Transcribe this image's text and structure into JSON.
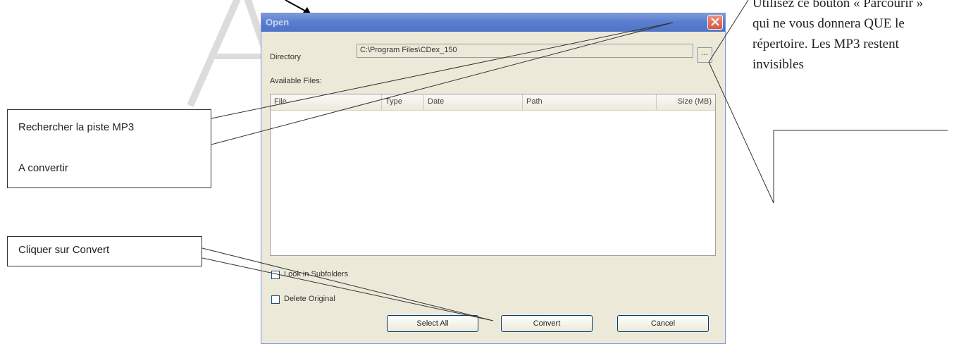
{
  "dialog": {
    "title": "Open",
    "directory_label": "Directory",
    "directory_value": "C:\\Program Files\\CDex_150",
    "browse_label": "...",
    "available_files_label": "Available Files:",
    "columns": [
      "File",
      "Type",
      "Date",
      "Path",
      "Size (MB)"
    ],
    "look_in_subfolders_label": "Look in Subfolders",
    "delete_original_label": "Delete Original",
    "select_all_label": "Select All",
    "convert_label": "Convert",
    "cancel_label": "Cancel"
  },
  "callouts": {
    "search_line1": "Rechercher la piste MP3",
    "search_line2": "A  convertir",
    "convert": "Cliquer sur Convert",
    "browse_note": "Utilisez ce bouton « Parcourir »  qui ne vous donnera QUE le répertoire. Les MP3 restent invisibles"
  },
  "colors": {
    "titlebar": "#5a7ed0",
    "dialog_bg": "#ece9d8",
    "close_button": "#d9573d"
  }
}
